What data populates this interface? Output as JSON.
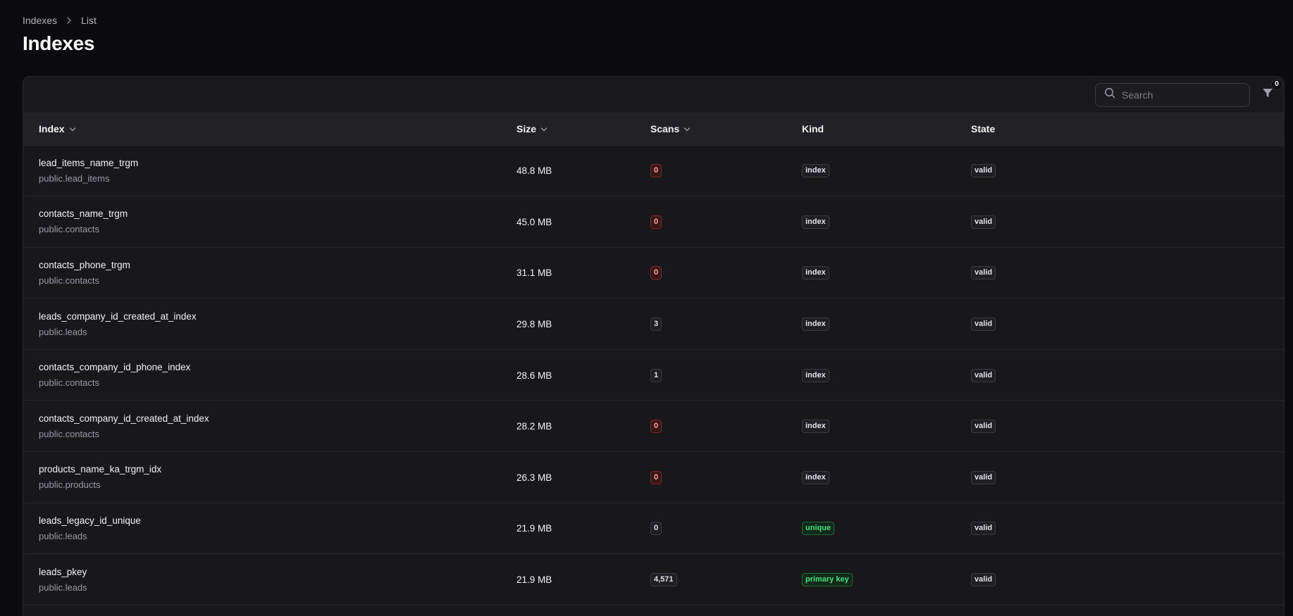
{
  "breadcrumb": {
    "root": "Indexes",
    "current": "List"
  },
  "page_title": "Indexes",
  "toolbar": {
    "search_placeholder": "Search",
    "filter_count": "0"
  },
  "table": {
    "columns": {
      "index": "Index",
      "size": "Size",
      "scans": "Scans",
      "kind": "Kind",
      "state": "State"
    },
    "rows": [
      {
        "name": "lead_items_name_trgm",
        "table": "public.lead_items",
        "size": "48.8 MB",
        "scans": "0",
        "scans_style": "zero-red",
        "kind": "index",
        "kind_style": "plain",
        "state": "valid"
      },
      {
        "name": "contacts_name_trgm",
        "table": "public.contacts",
        "size": "45.0 MB",
        "scans": "0",
        "scans_style": "zero-red",
        "kind": "index",
        "kind_style": "plain",
        "state": "valid"
      },
      {
        "name": "contacts_phone_trgm",
        "table": "public.contacts",
        "size": "31.1 MB",
        "scans": "0",
        "scans_style": "zero-red",
        "kind": "index",
        "kind_style": "plain",
        "state": "valid"
      },
      {
        "name": "leads_company_id_created_at_index",
        "table": "public.leads",
        "size": "29.8 MB",
        "scans": "3",
        "scans_style": "plain",
        "kind": "index",
        "kind_style": "plain",
        "state": "valid"
      },
      {
        "name": "contacts_company_id_phone_index",
        "table": "public.contacts",
        "size": "28.6 MB",
        "scans": "1",
        "scans_style": "plain",
        "kind": "index",
        "kind_style": "plain",
        "state": "valid"
      },
      {
        "name": "contacts_company_id_created_at_index",
        "table": "public.contacts",
        "size": "28.2 MB",
        "scans": "0",
        "scans_style": "zero-red",
        "kind": "index",
        "kind_style": "plain",
        "state": "valid"
      },
      {
        "name": "products_name_ka_trgm_idx",
        "table": "public.products",
        "size": "26.3 MB",
        "scans": "0",
        "scans_style": "zero-red",
        "kind": "index",
        "kind_style": "plain",
        "state": "valid"
      },
      {
        "name": "leads_legacy_id_unique",
        "table": "public.leads",
        "size": "21.9 MB",
        "scans": "0",
        "scans_style": "plain",
        "kind": "unique",
        "kind_style": "green",
        "state": "valid"
      },
      {
        "name": "leads_pkey",
        "table": "public.leads",
        "size": "21.9 MB",
        "scans": "4,571",
        "scans_style": "plain",
        "kind": "primary key",
        "kind_style": "green",
        "state": "valid"
      }
    ]
  },
  "icons": {
    "breadcrumb_sep": "chevron-right-icon",
    "search": "search-icon",
    "filter": "filter-icon",
    "sort": "chevron-down-icon"
  }
}
